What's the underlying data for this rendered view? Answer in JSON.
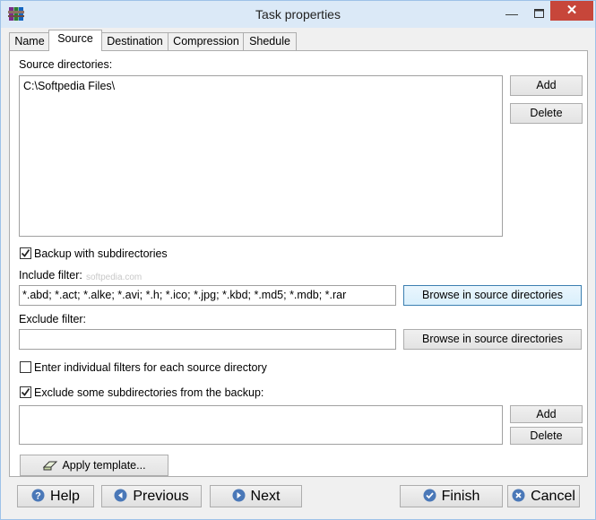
{
  "window": {
    "title": "Task properties"
  },
  "tabs": [
    {
      "label": "Name"
    },
    {
      "label": "Source"
    },
    {
      "label": "Destination"
    },
    {
      "label": "Compression"
    },
    {
      "label": "Shedule"
    }
  ],
  "source": {
    "source_dirs_label": "Source directories:",
    "source_dirs": [
      "C:\\Softpedia Files\\"
    ],
    "add_label": "Add",
    "delete_label": "Delete",
    "backup_subdirs_label": "Backup with subdirectories",
    "include_filter_label": "Include filter:",
    "include_filter_value": "*.abd; *.act; *.alke; *.avi; *.h; *.ico; *.jpg; *.kbd; *.md5; *.mdb; *.rar",
    "browse_label": "Browse in source directories",
    "exclude_filter_label": "Exclude filter:",
    "exclude_filter_value": "",
    "individual_filters_label": "Enter individual filters for each source directory",
    "exclude_subdirs_label": "Exclude some subdirectories from the backup:",
    "apply_template_label": "Apply template...",
    "watermark": "softpedia.com"
  },
  "checkboxes": {
    "backup_subdirs": true,
    "individual_filters": false,
    "exclude_subdirs": true
  },
  "footer": {
    "help_label": "Help",
    "previous_label": "Previous",
    "next_label": "Next",
    "finish_label": "Finish",
    "cancel_label": "Cancel"
  },
  "colors": {
    "accent": "#3c7fb1",
    "close": "#c7463a",
    "titlebar": "#dbe9f7"
  }
}
